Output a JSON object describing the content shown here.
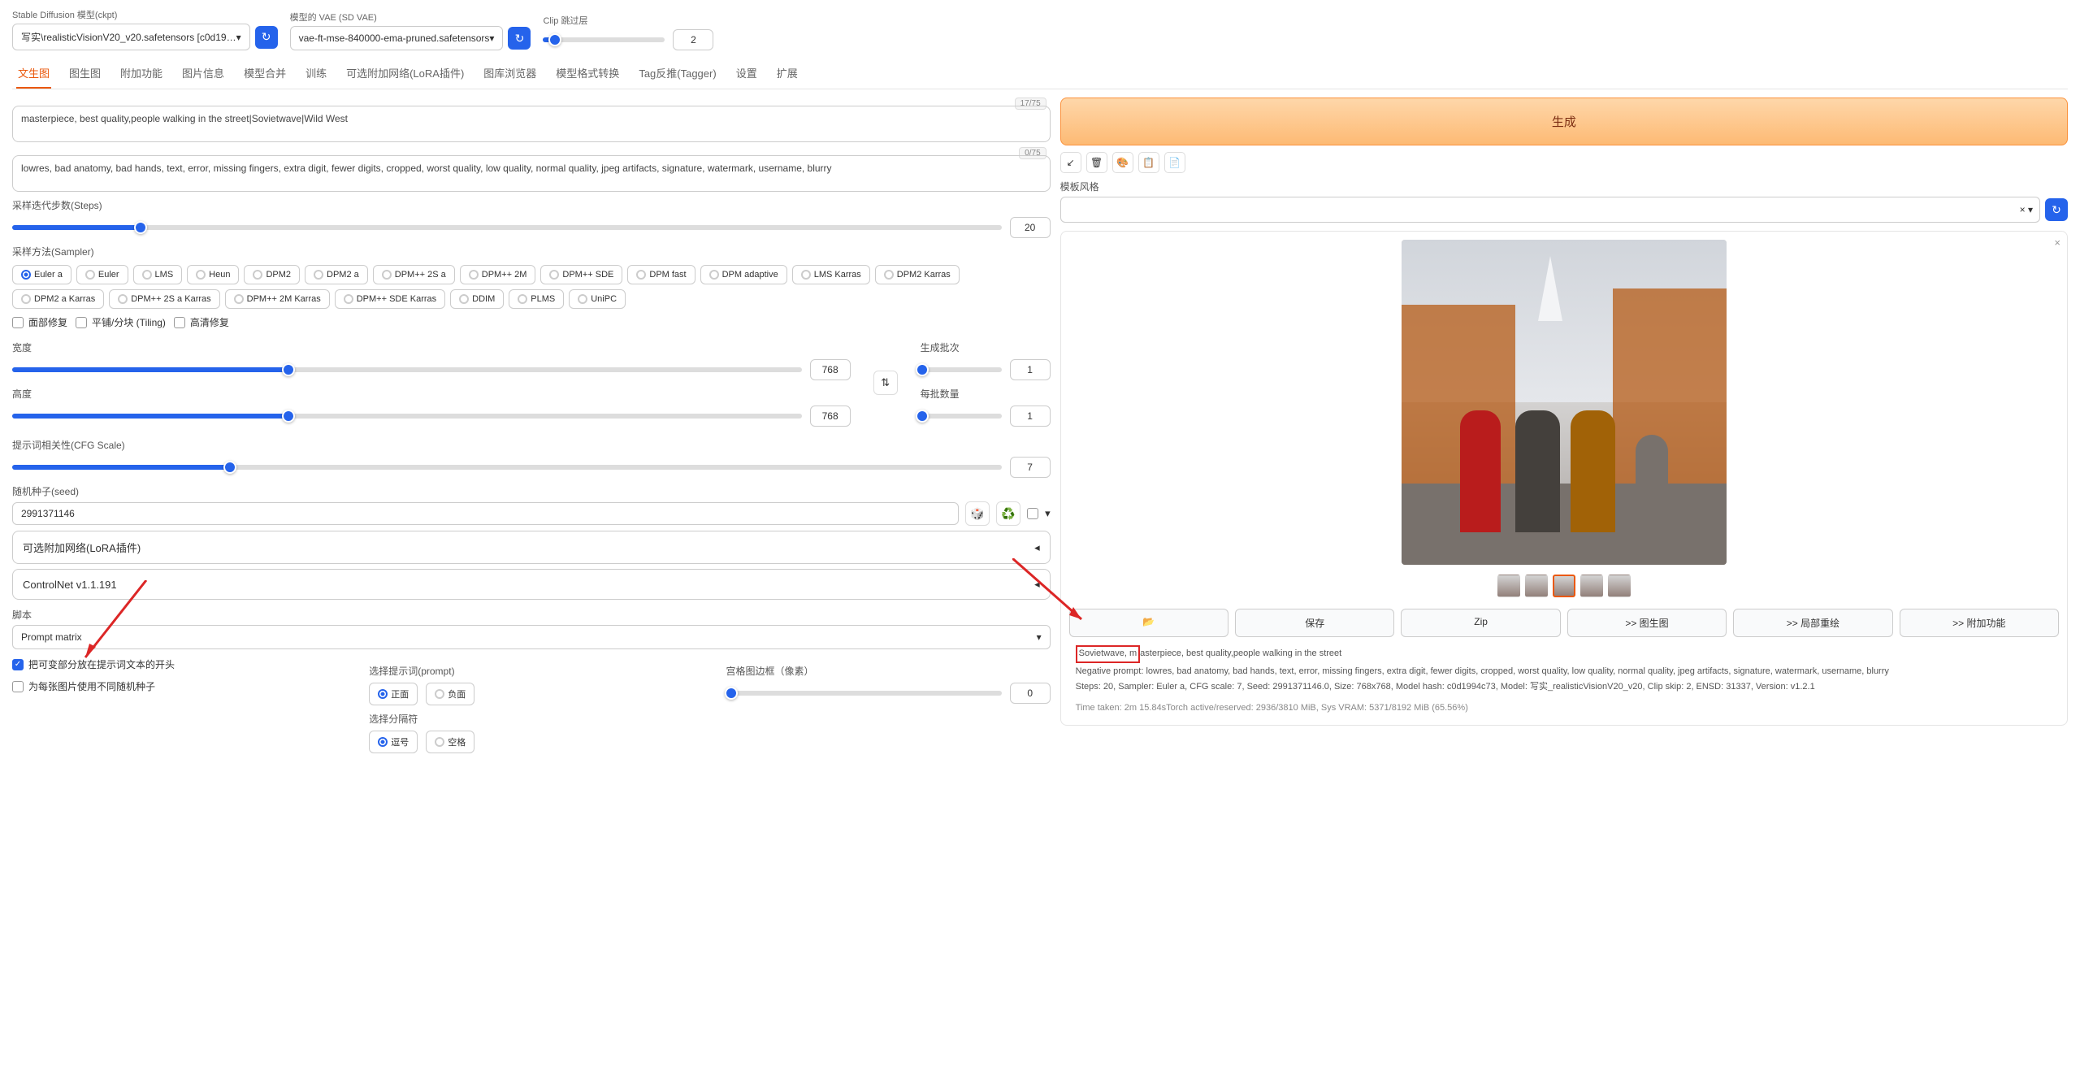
{
  "header": {
    "ckpt_label": "Stable Diffusion 模型(ckpt)",
    "ckpt_value": "写实\\realisticVisionV20_v20.safetensors [c0d19…",
    "vae_label": "模型的 VAE (SD VAE)",
    "vae_value": "vae-ft-mse-840000-ema-pruned.safetensors",
    "clip_label": "Clip 跳过层",
    "clip_value": "2"
  },
  "tabs": [
    "文生图",
    "图生图",
    "附加功能",
    "图片信息",
    "模型合并",
    "训练",
    "可选附加网络(LoRA插件)",
    "图库浏览器",
    "模型格式转换",
    "Tag反推(Tagger)",
    "设置",
    "扩展"
  ],
  "prompt": {
    "positive": "masterpiece, best quality,people walking in the street|Sovietwave|Wild West",
    "pos_count": "17/75",
    "negative": "lowres, bad anatomy, bad hands, text, error, missing fingers, extra digit, fewer digits, cropped, worst quality, low quality, normal quality, jpeg artifacts, signature, watermark, username, blurry",
    "neg_count": "0/75"
  },
  "steps": {
    "label": "采样迭代步数(Steps)",
    "value": "20"
  },
  "sampler_label": "采样方法(Sampler)",
  "samplers": [
    "Euler a",
    "Euler",
    "LMS",
    "Heun",
    "DPM2",
    "DPM2 a",
    "DPM++ 2S a",
    "DPM++ 2M",
    "DPM++ SDE",
    "DPM fast",
    "DPM adaptive",
    "LMS Karras",
    "DPM2 Karras",
    "DPM2 a Karras",
    "DPM++ 2S a Karras",
    "DPM++ 2M Karras",
    "DPM++ SDE Karras",
    "DDIM",
    "PLMS",
    "UniPC"
  ],
  "restore_face": "面部修复",
  "tiling": "平铺/分块 (Tiling)",
  "hires": "高清修复",
  "width": {
    "label": "宽度",
    "value": "768"
  },
  "height": {
    "label": "高度",
    "value": "768"
  },
  "batch_count": {
    "label": "生成批次",
    "value": "1"
  },
  "batch_size": {
    "label": "每批数量",
    "value": "1"
  },
  "cfg": {
    "label": "提示词相关性(CFG Scale)",
    "value": "7"
  },
  "seed": {
    "label": "随机种子(seed)",
    "value": "2991371146"
  },
  "lora": "可选附加网络(LoRA插件)",
  "controlnet": "ControlNet v1.1.191",
  "script": {
    "label": "脚本",
    "value": "Prompt matrix",
    "opt1": "把可变部分放在提示词文本的开头",
    "opt2": "为每张图片使用不同随机种子",
    "select_prompt": "选择提示词(prompt)",
    "positive": "正面",
    "negative": "负面",
    "select_delim": "选择分隔符",
    "comma": "逗号",
    "space": "空格",
    "margin": "宫格图边框（像素）",
    "margin_val": "0"
  },
  "gen": "生成",
  "style_label": "模板风格",
  "out_buttons": {
    "folder": "📂",
    "save": "保存",
    "zip": "Zip",
    "img2img": ">> 图生图",
    "inpaint": ">> 局部重绘",
    "extras": ">> 附加功能"
  },
  "info": {
    "l1": "Sovietwave, masterpiece, best quality,people walking in the street",
    "l2": "Negative prompt: lowres, bad anatomy, bad hands, text, error, missing fingers, extra digit, fewer digits, cropped, worst quality, low quality, normal quality, jpeg artifacts, signature, watermark, username, blurry",
    "l3": "Steps: 20, Sampler: Euler a, CFG scale: 7, Seed: 2991371146.0, Size: 768x768, Model hash: c0d1994c73, Model: 写实_realisticVisionV20_v20, Clip skip: 2, ENSD: 31337, Version: v1.2.1",
    "l4": "Time taken: 2m 15.84sTorch active/reserved: 2936/3810 MiB, Sys VRAM: 5371/8192 MiB (65.56%)"
  }
}
